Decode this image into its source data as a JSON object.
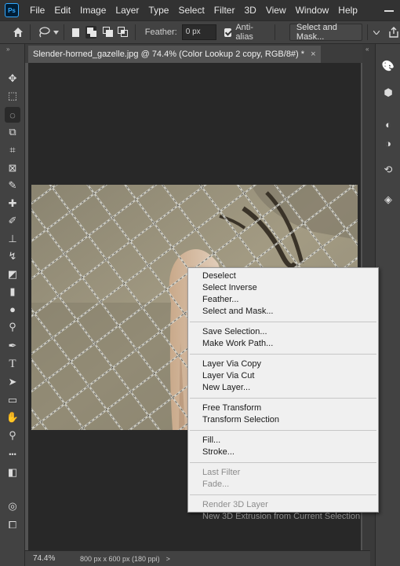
{
  "app": {
    "logo_text": "Ps"
  },
  "menubar": {
    "items": [
      "File",
      "Edit",
      "Image",
      "Layer",
      "Type",
      "Select",
      "Filter",
      "3D",
      "View",
      "Window",
      "Help"
    ]
  },
  "options": {
    "feather_label": "Feather:",
    "feather_value": "0 px",
    "antialias_label": "Anti-alias",
    "antialias_checked": true,
    "select_mask_label": "Select and Mask..."
  },
  "document": {
    "tab_title": "Slender-horned_gazelle.jpg @ 74.4% (Color Lookup 2 copy, RGB/8#) *",
    "close_glyph": "×"
  },
  "status": {
    "zoom": "74.4%",
    "doc_size": "800 px x 600 px (180 ppi)",
    "arrow": ">"
  },
  "context_menu": {
    "groups": [
      [
        {
          "label": "Deselect",
          "enabled": true
        },
        {
          "label": "Select Inverse",
          "enabled": true
        },
        {
          "label": "Feather...",
          "enabled": true
        },
        {
          "label": "Select and Mask...",
          "enabled": true
        }
      ],
      [
        {
          "label": "Save Selection...",
          "enabled": true
        },
        {
          "label": "Make Work Path...",
          "enabled": true
        }
      ],
      [
        {
          "label": "Layer Via Copy",
          "enabled": true
        },
        {
          "label": "Layer Via Cut",
          "enabled": true
        },
        {
          "label": "New Layer...",
          "enabled": true
        }
      ],
      [
        {
          "label": "Free Transform",
          "enabled": true
        },
        {
          "label": "Transform Selection",
          "enabled": true
        }
      ],
      [
        {
          "label": "Fill...",
          "enabled": true
        },
        {
          "label": "Stroke...",
          "enabled": true
        }
      ],
      [
        {
          "label": "Last Filter",
          "enabled": false
        },
        {
          "label": "Fade...",
          "enabled": false
        }
      ],
      [
        {
          "label": "Render 3D Layer",
          "enabled": false
        },
        {
          "label": "New 3D Extrusion from Current Selection",
          "enabled": false
        }
      ]
    ]
  },
  "left_tools": [
    "move-icon",
    "marquee-icon",
    "lasso-icon",
    "object-select-icon",
    "crop-icon",
    "frame-icon",
    "eyedropper-icon",
    "healing-icon",
    "brush-icon",
    "stamp-icon",
    "history-brush-icon",
    "eraser-icon",
    "gradient-icon",
    "blur-icon",
    "dodge-icon",
    "pen-icon",
    "type-icon",
    "path-select-icon",
    "rectangle-icon",
    "hand-icon",
    "zoom-icon",
    "more-tools-icon",
    "colors-icon",
    "quick-mask-icon",
    "screen-mode-icon"
  ],
  "right_tools": [
    "palette-icon",
    "3d-icon",
    "adjustments-icon",
    "color-icon",
    "paths-icon",
    "layers-icon"
  ]
}
